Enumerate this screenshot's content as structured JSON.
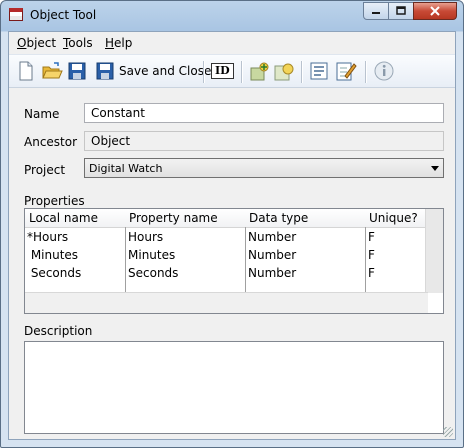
{
  "window": {
    "title": "Object Tool",
    "icons": {
      "app": "app-window-icon",
      "minimize": "minimize-icon",
      "maximize": "maximize-icon",
      "close": "close-icon"
    }
  },
  "menu": {
    "items": [
      "Object",
      "Tools",
      "Help"
    ]
  },
  "toolbar": {
    "save_close_label": "Save and Close",
    "id_label": "ID",
    "icons": [
      "new-document-icon",
      "open-folder-icon",
      "save-icon",
      "save-and-close-icon",
      "id-icon",
      "add-object-icon",
      "object-image-icon",
      "properties-list-icon",
      "edit-document-icon",
      "info-icon"
    ]
  },
  "form": {
    "name_label": "Name",
    "name_value": "Constant",
    "ancestor_label": "Ancestor",
    "ancestor_value": "Object",
    "project_label": "Project",
    "project_value": "Digital Watch"
  },
  "properties": {
    "label": "Properties",
    "columns": [
      "Local name",
      "Property name",
      "Data type",
      "Unique?"
    ],
    "rows": [
      [
        "*Hours",
        "Hours",
        "Number",
        "F"
      ],
      [
        " Minutes",
        "Minutes",
        "Number",
        "F"
      ],
      [
        " Seconds",
        "Seconds",
        "Number",
        "F"
      ]
    ]
  },
  "description": {
    "label": "Description",
    "value": ""
  },
  "colors": {
    "title_bar": "#bcd3ea",
    "close_button": "#c84a36",
    "client": "#f0f0f0"
  }
}
